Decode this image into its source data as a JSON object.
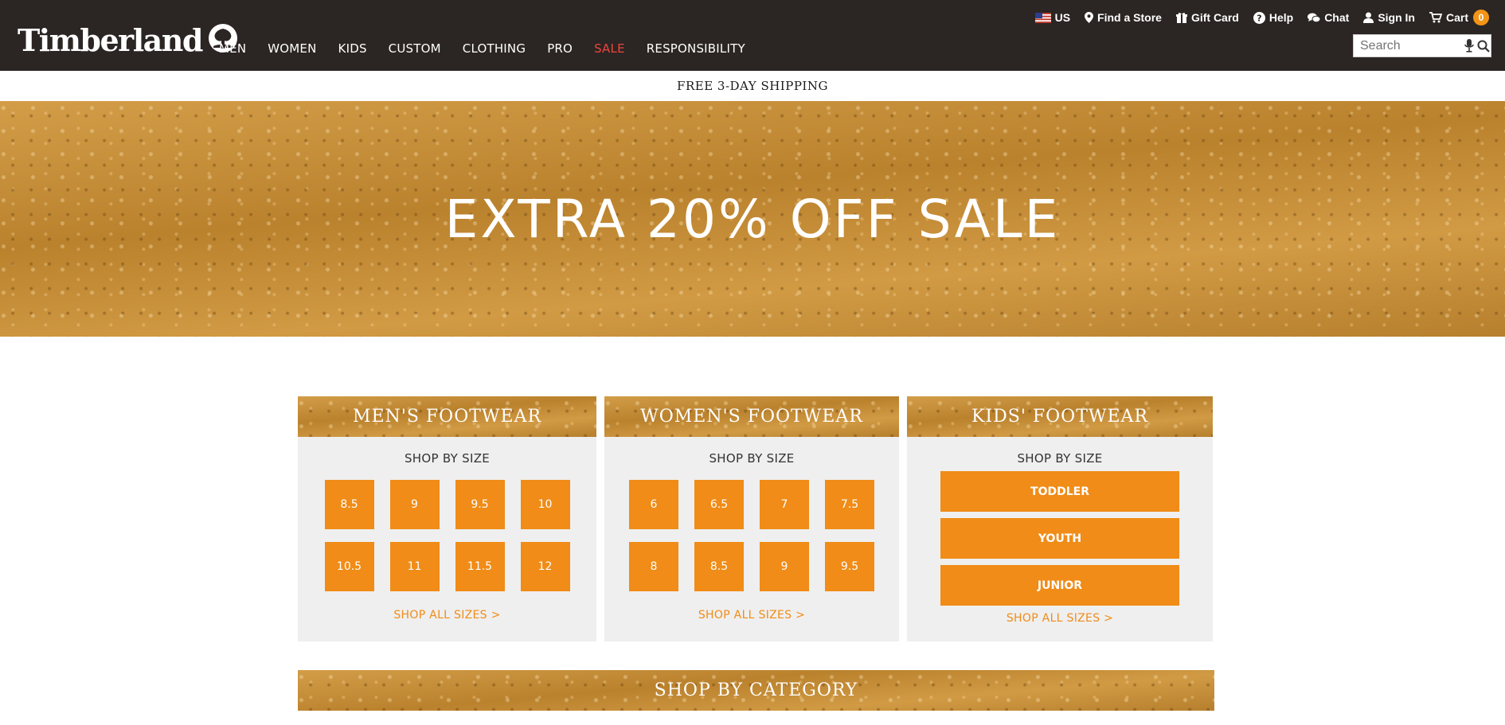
{
  "header": {
    "logo_text": "Timberland",
    "nav": [
      "MEN",
      "WOMEN",
      "KIDS",
      "CUSTOM",
      "CLOTHING",
      "PRO",
      "SALE",
      "RESPONSIBILITY"
    ],
    "utility": {
      "country": "US",
      "find_store": "Find a Store",
      "gift_card": "Gift Card",
      "help": "Help",
      "chat": "Chat",
      "sign_in": "Sign In",
      "cart": "Cart",
      "cart_count": "0"
    },
    "search_placeholder": "Search"
  },
  "promo": "FREE 3-DAY SHIPPING",
  "hero": {
    "title": "EXTRA 20% OFF SALE"
  },
  "cards": {
    "men": {
      "title": "MEN'S FOOTWEAR",
      "subtitle": "SHOP BY SIZE",
      "sizes": [
        "8.5",
        "9",
        "9.5",
        "10",
        "10.5",
        "11",
        "11.5",
        "12"
      ],
      "all_link": "SHOP ALL SIZES >"
    },
    "women": {
      "title": "WOMEN'S FOOTWEAR",
      "subtitle": "SHOP BY SIZE",
      "sizes": [
        "6",
        "6.5",
        "7",
        "7.5",
        "8",
        "8.5",
        "9",
        "9.5"
      ],
      "all_link": "SHOP ALL SIZES >"
    },
    "kids": {
      "title": "KIDS' FOOTWEAR",
      "subtitle": "SHOP BY SIZE",
      "buttons": [
        "TODDLER",
        "YOUTH",
        "JUNIOR"
      ],
      "all_link": "SHOP ALL SIZES >"
    }
  },
  "category": {
    "title": "SHOP BY CATEGORY"
  },
  "colors": {
    "header_bg": "#2b2523",
    "accent": "#f08c17",
    "sale": "#f0453a",
    "card_bg": "#efefef",
    "texture": "#c98f35"
  }
}
